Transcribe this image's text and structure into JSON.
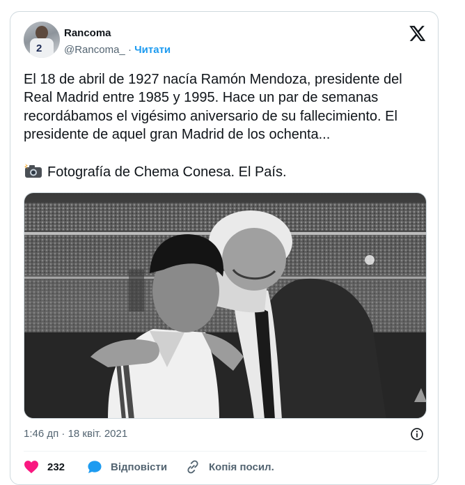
{
  "author": {
    "name": "Rancoma",
    "handle": "@Rancoma_",
    "separator": "·",
    "follow_label": "Читати",
    "avatar_number": "2"
  },
  "tweet": {
    "text": "El 18 de abril de 1927 nacía Ramón Mendoza, presidente del Real Madrid entre 1985 y 1995. Hace un par de semanas recordábamos el vigésimo aniversario de su fallecimiento. El presidente de aquel gran Madrid de los ochenta...",
    "photo_credit": "Fotografía de Chema Conesa. El País.",
    "timestamp": "1:46 дп · 18 квіт. 2021"
  },
  "actions": {
    "likes": "232",
    "reply_label": "Відповісти",
    "copy_link_label": "Копія посил."
  },
  "colors": {
    "accent": "#1d9bf0",
    "like": "#f91880",
    "muted": "#536471",
    "border": "#cfd9de"
  },
  "icons": [
    "x-logo-icon",
    "camera-flash-icon",
    "info-icon",
    "heart-icon",
    "reply-bubble-icon",
    "link-icon"
  ]
}
